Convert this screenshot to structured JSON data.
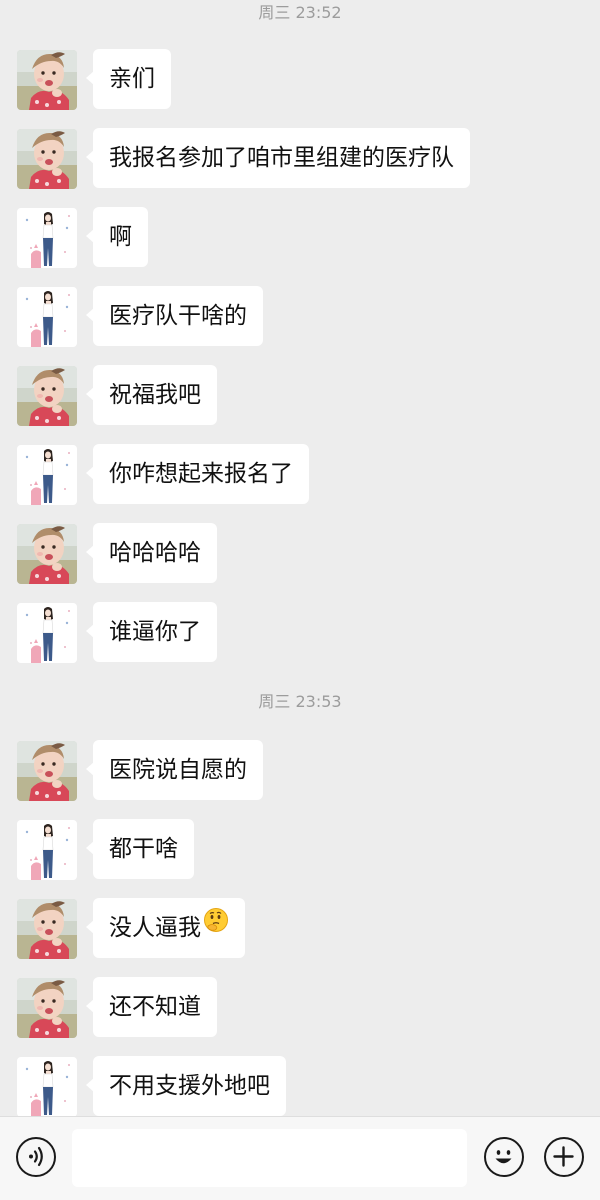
{
  "timestamps": {
    "top": "周三 23:52",
    "middle": "周三 23:53"
  },
  "avatars": {
    "friend": "baby-photo-avatar",
    "user": "girl-illustration-avatar"
  },
  "messages": [
    {
      "sender": "friend",
      "text": "亲们"
    },
    {
      "sender": "friend",
      "text": "我报名参加了咱市里组建的医疗队"
    },
    {
      "sender": "user",
      "text": "啊"
    },
    {
      "sender": "user",
      "text": "医疗队干啥的"
    },
    {
      "sender": "friend",
      "text": "祝福我吧"
    },
    {
      "sender": "user",
      "text": "你咋想起来报名了"
    },
    {
      "sender": "friend",
      "text": "哈哈哈哈"
    },
    {
      "sender": "user",
      "text": "谁逼你了"
    },
    {
      "sender": "friend",
      "text": "医院说自愿的"
    },
    {
      "sender": "user",
      "text": "都干啥"
    },
    {
      "sender": "friend",
      "text": "没人逼我",
      "emoji": "thinking-face-emoji"
    },
    {
      "sender": "friend",
      "text": "还不知道"
    },
    {
      "sender": "user",
      "text": "不用支援外地吧"
    }
  ],
  "bottom_bar": {
    "voice_icon": "voice-icon",
    "emoji_icon": "smiley-icon",
    "plus_icon": "plus-icon",
    "input_value": ""
  },
  "colors": {
    "background": "#ededed",
    "bubble": "#ffffff",
    "text": "#111111",
    "timestamp": "#9c9c9c"
  }
}
